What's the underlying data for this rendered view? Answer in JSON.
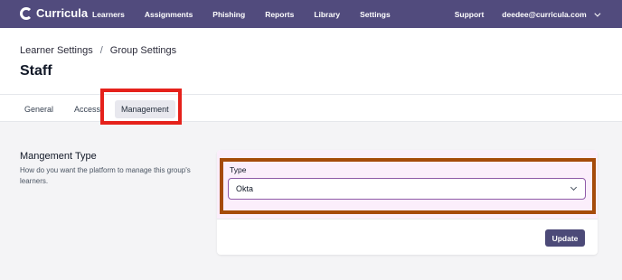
{
  "brand": {
    "name": "Curricula"
  },
  "nav": {
    "items": [
      {
        "label": "Learners"
      },
      {
        "label": "Assignments"
      },
      {
        "label": "Phishing"
      },
      {
        "label": "Reports"
      },
      {
        "label": "Library"
      },
      {
        "label": "Settings"
      }
    ],
    "support": "Support",
    "user_email": "deedee@curricula.com"
  },
  "breadcrumb": {
    "items": [
      "Learner Settings",
      "Group Settings"
    ],
    "separator": "/"
  },
  "page": {
    "title": "Staff"
  },
  "tabs": [
    {
      "label": "General",
      "active": false
    },
    {
      "label": "Access",
      "active": false
    },
    {
      "label": "Management",
      "active": true
    }
  ],
  "section": {
    "title": "Mangement Type",
    "description": "How do you want the platform to manage this group's learners."
  },
  "form": {
    "type_label": "Type",
    "type_value": "Okta",
    "submit_label": "Update"
  },
  "colors": {
    "nav_bg": "#514b7d",
    "highlight_red": "#e5211b",
    "highlight_brown": "#a54b0a",
    "button_bg": "#4c4a78"
  }
}
